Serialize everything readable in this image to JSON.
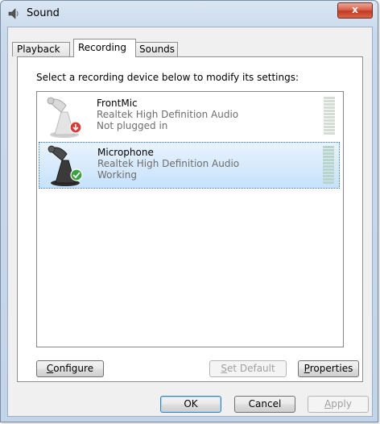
{
  "window": {
    "title": "Sound",
    "close_label": "x"
  },
  "tabs": [
    {
      "label": "Playback",
      "active": false
    },
    {
      "label": "Recording",
      "active": true
    },
    {
      "label": "Sounds",
      "active": false
    }
  ],
  "instruction": "Select a recording device below to modify its settings:",
  "devices": [
    {
      "name": "FrontMic",
      "description": "Realtek High Definition Audio",
      "status": "Not plugged in",
      "status_badge": "down-arrow-badge",
      "badge_color": "#c0282a",
      "selected": false
    },
    {
      "name": "Microphone",
      "description": "Realtek High Definition Audio",
      "status": "Working",
      "status_badge": "check-badge",
      "badge_color": "#2f9e36",
      "selected": true
    }
  ],
  "buttons": {
    "configure": {
      "label_accel": "C",
      "label_rest": "onfigure"
    },
    "set_default": {
      "label_accel": "S",
      "label_rest": "et Default"
    },
    "properties": {
      "label_accel": "P",
      "label_rest": "roperties"
    },
    "ok": "OK",
    "cancel": "Cancel",
    "apply": {
      "label_accel": "A",
      "label_rest": "pply"
    }
  }
}
